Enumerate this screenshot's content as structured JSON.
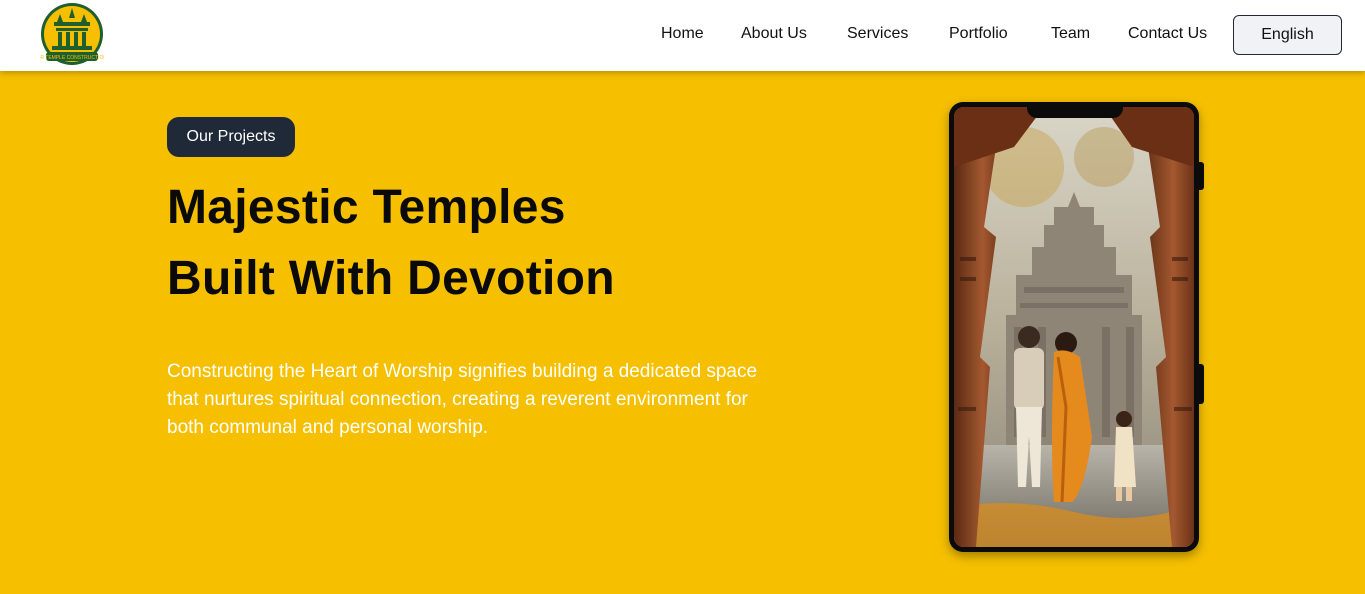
{
  "brand": {
    "logo_text": "SR TEMPLE CONSTRUCTION"
  },
  "nav": {
    "items": [
      {
        "label": "Home"
      },
      {
        "label": "About Us"
      },
      {
        "label": "Services"
      },
      {
        "label": "Portfolio"
      },
      {
        "label": "Team"
      },
      {
        "label": "Contact Us"
      }
    ],
    "language": "English"
  },
  "hero": {
    "badge": "Our Projects",
    "title_line1": "Majestic Temples",
    "title_line2": "Built With Devotion",
    "description": "Constructing the Heart of Worship signifies building a dedicated space that nurtures spiritual connection, creating a reverent environment for both communal and personal worship."
  },
  "colors": {
    "accent": "#f6c000",
    "dark": "#1f2937",
    "text": "#0a0a0a"
  }
}
